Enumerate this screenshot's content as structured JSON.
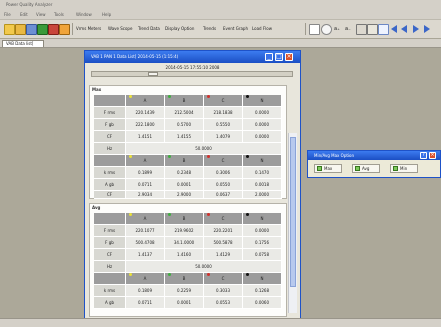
{
  "app": {
    "title": "Power Quality Analyzer"
  },
  "menu": [
    "File",
    "Edit",
    "View",
    "Tools",
    "Window",
    "Help"
  ],
  "toolbar": {
    "items": [
      "Vrms Meters",
      "Wave Scope",
      "Trend Data",
      "Display Option",
      "Trends",
      "Event Graph",
      "Load Flow"
    ]
  },
  "tabs": {
    "data_tab": "VAB Data list["
  },
  "data_window": {
    "title": "VAB 1 PAN 1 Data List[ 2014-05-15 (1:15:4)",
    "date_text": "2014-05-15 17:55:10 2008"
  },
  "sections": [
    {
      "label": "Max",
      "header_cols": [
        "",
        "A",
        "B",
        "C",
        "N"
      ],
      "rows": [
        {
          "label": "F rms",
          "values": [
            "220.1439",
            "212.5004",
            "218.1838",
            "0.0000"
          ]
        },
        {
          "label": "F gb",
          "values": [
            "222.1800",
            "0.5700",
            "0.5550",
            "0.0000"
          ]
        },
        {
          "label": "CF",
          "values": [
            "1.4151",
            "1.4155",
            "1.4079",
            "0.0000"
          ]
        },
        {
          "label": "Hz",
          "span": "50.0000"
        }
      ],
      "header2_cols": [
        "",
        "A",
        "B",
        "C",
        "N"
      ],
      "rows2": [
        {
          "label": "k rms",
          "values": [
            "0.1899",
            "0.2348",
            "0.3006",
            "0.1470"
          ]
        },
        {
          "label": "A gb",
          "values": [
            "0.0711",
            "0.0001",
            "0.0550",
            "0.0018"
          ]
        },
        {
          "label": "CF",
          "values": [
            "2.9034",
            "2.9000",
            "0.0637",
            "2.0000"
          ]
        }
      ]
    },
    {
      "label": "Avg",
      "header_cols": [
        "",
        "A",
        "B",
        "C",
        "N"
      ],
      "rows": [
        {
          "label": "F rms",
          "values": [
            "220.1077",
            "219.9602",
            "220.2201",
            "0.0000"
          ]
        },
        {
          "label": "F gb",
          "values": [
            "500.4708",
            "34.1.0000",
            "500.5878",
            "0.1756"
          ]
        },
        {
          "label": "CF",
          "values": [
            "1.4137",
            "1.4160",
            "1.4129",
            "0.0758"
          ]
        },
        {
          "label": "Hz",
          "span": "50.0000"
        }
      ],
      "header2_cols": [
        "",
        "A",
        "B",
        "C",
        "N"
      ],
      "rows2": [
        {
          "label": "k rms",
          "values": [
            "0.1809",
            "0.2259",
            "0.3033",
            "0.1268"
          ]
        },
        {
          "label": "A gb",
          "values": [
            "0.0711",
            "0.0001",
            "0.0553",
            "0.0060"
          ]
        }
      ]
    }
  ],
  "phase_colors": {
    "A": "#e8e03a",
    "B": "#3fae3f",
    "C": "#d0322c",
    "N": "#111111"
  },
  "options_window": {
    "title": "Min/Avg Max Option",
    "options": [
      "Max",
      "Avg",
      "Min"
    ]
  }
}
